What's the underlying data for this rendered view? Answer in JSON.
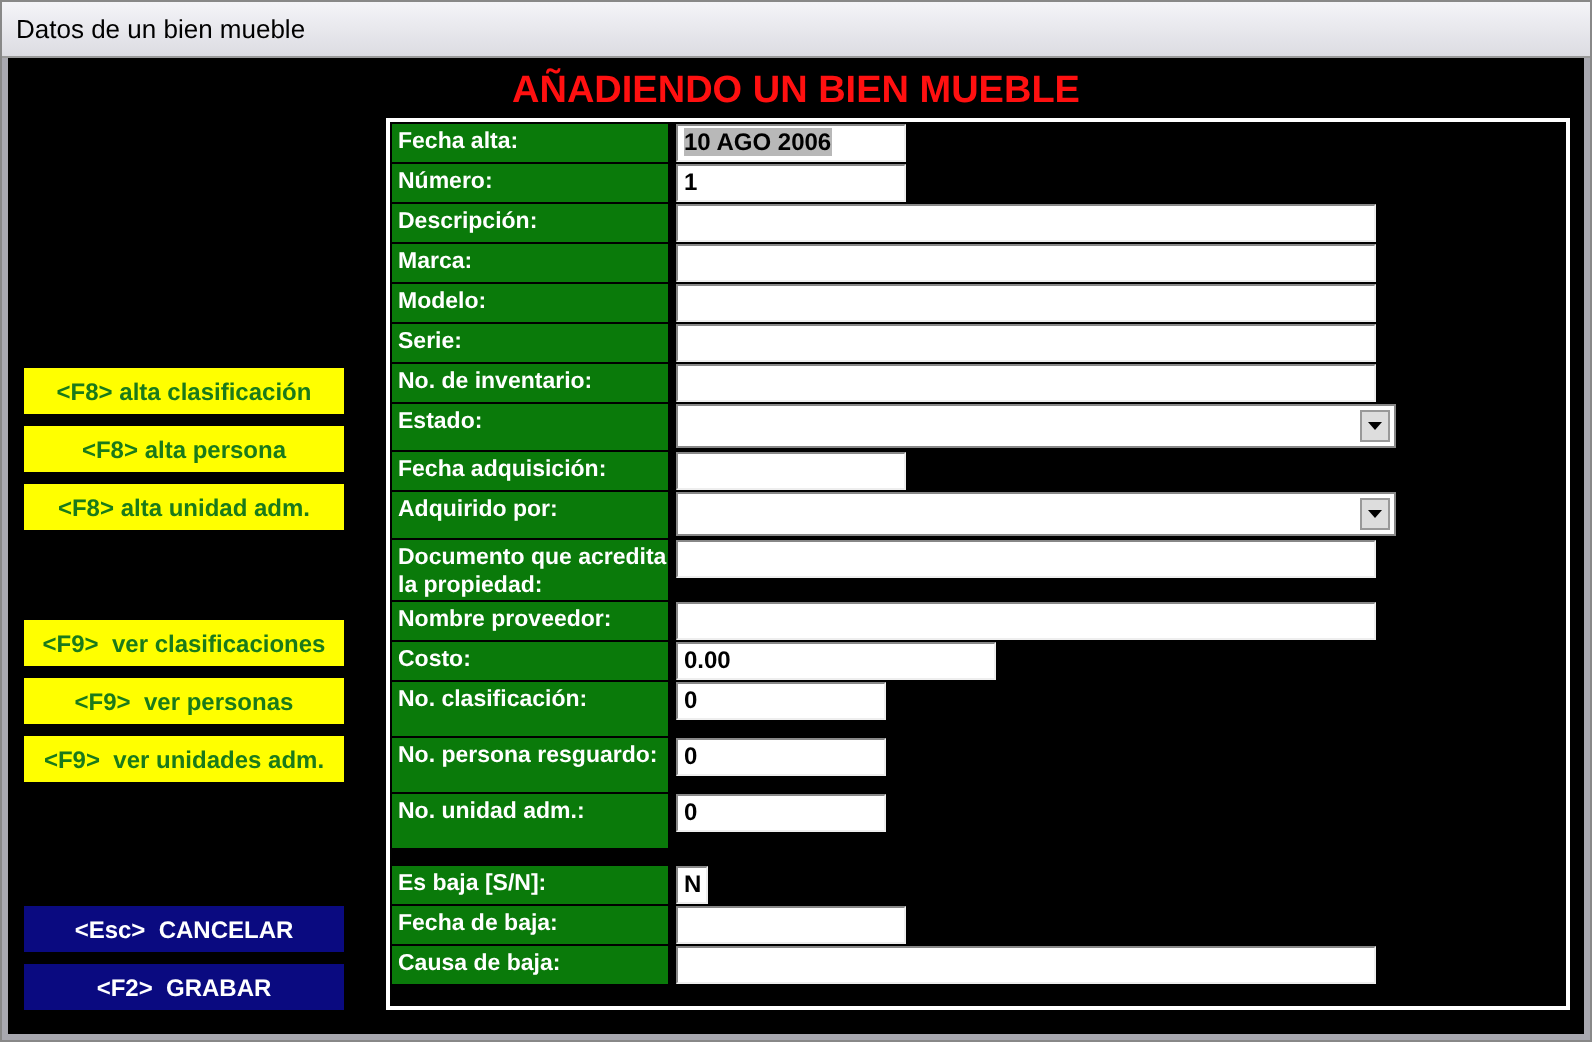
{
  "window": {
    "title": "Datos de un bien mueble"
  },
  "heading": "AÑADIENDO UN BIEN MUEBLE",
  "button_groups": [
    {
      "kind": "shortcut",
      "buttons": [
        "<F8> alta clasificación",
        "<F8> alta persona",
        "<F8> alta unidad adm."
      ]
    },
    {
      "kind": "shortcut",
      "buttons": [
        "<F9>  ver clasificaciones",
        "<F9>  ver personas",
        "<F9>  ver unidades adm."
      ]
    },
    {
      "kind": "action",
      "buttons": [
        "<Esc>  CANCELAR",
        "<F2>  GRABAR"
      ]
    }
  ],
  "fields": [
    {
      "label": "Fecha alta:",
      "kind": "date",
      "value": "10 AGO 2006",
      "text_selected": true
    },
    {
      "label": "Número:",
      "kind": "date",
      "value": "1",
      "text_selected": false
    },
    {
      "label": "Descripción:",
      "kind": "wide"
    },
    {
      "label": "Marca:",
      "kind": "wide"
    },
    {
      "label": "Modelo:",
      "kind": "wide"
    },
    {
      "label": "Serie:",
      "kind": "wide"
    },
    {
      "label": "No. de inventario:",
      "kind": "wide"
    },
    {
      "label": "Estado:",
      "kind": "combo"
    },
    {
      "label": "Fecha adquisición:",
      "kind": "date"
    },
    {
      "label": "Adquirido por:",
      "kind": "combo"
    },
    {
      "label": "Documento que acredita la propiedad:",
      "kind": "wide"
    },
    {
      "label": "Nombre proveedor:",
      "kind": "wide"
    },
    {
      "label": "Costo:",
      "kind": "money",
      "value": "0.00",
      "text_selected": false
    },
    {
      "label": "No. clasificación:",
      "kind": "number",
      "value": "0",
      "text_selected": false
    },
    {
      "label": "No. persona resguardo:",
      "kind": "number",
      "value": "0",
      "text_selected": false
    },
    {
      "label": "No. unidad adm.:",
      "kind": "number",
      "value": "0",
      "text_selected": false
    },
    {
      "label": "Es baja [S/N]:",
      "kind": "flag",
      "value": "N",
      "text_selected": false
    },
    {
      "label": "Fecha de baja:",
      "kind": "date"
    },
    {
      "label": "Causa de baja:",
      "kind": "wide"
    }
  ]
}
